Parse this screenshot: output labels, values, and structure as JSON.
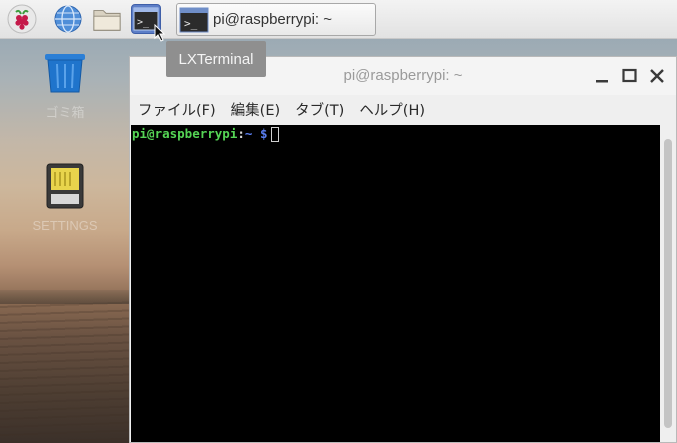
{
  "taskbar": {
    "launchers": [
      {
        "name": "raspberry-menu-icon"
      },
      {
        "name": "web-browser-icon"
      },
      {
        "name": "file-manager-icon"
      },
      {
        "name": "terminal-icon"
      }
    ],
    "task_button": {
      "label": "pi@raspberrypi: ~",
      "icon": "terminal-icon"
    }
  },
  "tooltip": {
    "text": "LXTerminal"
  },
  "desktop": {
    "icons": [
      {
        "name": "trash-icon",
        "label": "ゴミ箱"
      },
      {
        "name": "sd-card-icon",
        "label": "SETTINGS"
      }
    ]
  },
  "window": {
    "title": "pi@raspberrypi: ~",
    "controls": {
      "minimize": "minimize",
      "maximize": "maximize",
      "close": "close"
    },
    "menu": [
      "ファイル(F)",
      "編集(E)",
      "タブ(T)",
      "ヘルプ(H)"
    ],
    "terminal": {
      "user_host": "pi@raspberrypi",
      "separator": ":",
      "path": "~",
      "symbol": " $"
    }
  },
  "colors": {
    "terminal_bg": "#000000",
    "prompt_user": "#55d455",
    "prompt_path": "#5a7ef0",
    "active_launcher": "#5d7ec7"
  }
}
